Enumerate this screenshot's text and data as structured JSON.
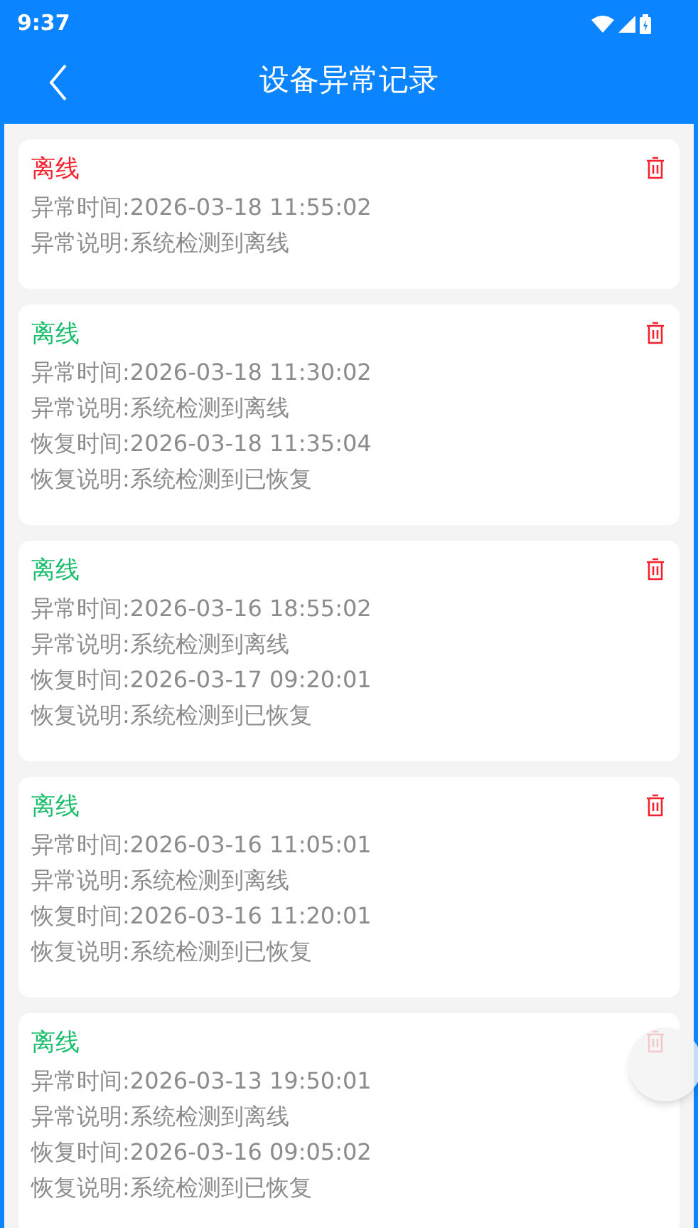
{
  "status_bar": {
    "time": "9:37"
  },
  "header": {
    "title": "设备异常记录"
  },
  "records": [
    {
      "status": "离线",
      "color": "#f5222d",
      "lines": [
        "异常时间:2026-03-18 11:55:02",
        "异常说明:系统检测到离线"
      ]
    },
    {
      "status": "离线",
      "color": "#19be6b",
      "lines": [
        "异常时间:2026-03-18 11:30:02",
        "异常说明:系统检测到离线",
        "恢复时间:2026-03-18 11:35:04",
        "恢复说明:系统检测到已恢复"
      ]
    },
    {
      "status": "离线",
      "color": "#19be6b",
      "lines": [
        "异常时间:2026-03-16 18:55:02",
        "异常说明:系统检测到离线",
        "恢复时间:2026-03-17 09:20:01",
        "恢复说明:系统检测到已恢复"
      ]
    },
    {
      "status": "离线",
      "color": "#19be6b",
      "lines": [
        "异常时间:2026-03-16 11:05:01",
        "异常说明:系统检测到离线",
        "恢复时间:2026-03-16 11:20:01",
        "恢复说明:系统检测到已恢复"
      ]
    },
    {
      "status": "离线",
      "color": "#19be6b",
      "lines": [
        "异常时间:2026-03-13 19:50:01",
        "异常说明:系统检测到离线",
        "恢复时间:2026-03-16 09:05:02",
        "恢复说明:系统检测到已恢复"
      ]
    }
  ]
}
